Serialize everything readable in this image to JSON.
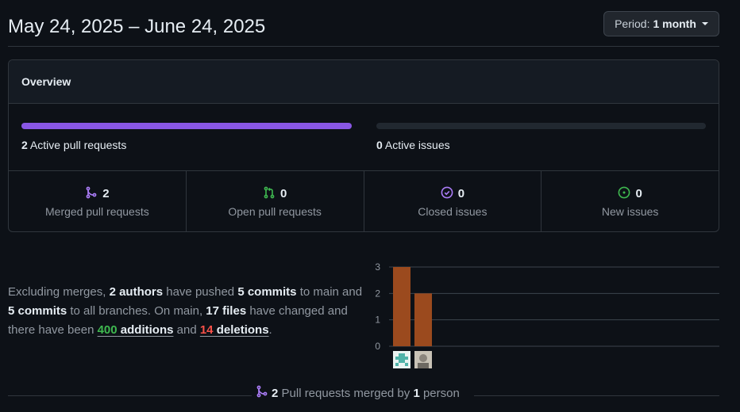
{
  "header": {
    "title": "May 24, 2025 – June 24, 2025",
    "period_label": "Period:",
    "period_value": "1 month"
  },
  "overview": {
    "title": "Overview",
    "active_prs": {
      "count": "2",
      "label": "Active pull requests",
      "fraction": 1.0
    },
    "active_issues": {
      "count": "0",
      "label": "Active issues",
      "fraction": 0.0
    },
    "stats": [
      {
        "icon": "merge-icon",
        "count": "2",
        "label": "Merged pull requests",
        "color": "#ab7df8"
      },
      {
        "icon": "pull-request-icon",
        "count": "0",
        "label": "Open pull requests",
        "color": "#3fb950"
      },
      {
        "icon": "issue-closed-icon",
        "count": "0",
        "label": "Closed issues",
        "color": "#ab7df8"
      },
      {
        "icon": "issue-opened-icon",
        "count": "0",
        "label": "New issues",
        "color": "#3fb950"
      }
    ]
  },
  "summary": {
    "t1": "Excluding merges, ",
    "authors": "2 authors",
    "t2": " have pushed ",
    "commits_main": "5 commits",
    "t3": " to main and ",
    "commits_all": "5 commits",
    "t4": " to all branches. On main, ",
    "files": "17 files",
    "t5": " have changed and there have been ",
    "additions_num": "400",
    "additions_word": " additions",
    "t6": " and ",
    "deletions_num": "14",
    "deletions_word": " deletions",
    "t7": "."
  },
  "chart_data": {
    "type": "bar",
    "categories": [
      "author-1",
      "author-2"
    ],
    "values": [
      3,
      2
    ],
    "ylim": [
      0,
      3
    ],
    "yticks": [
      "0",
      "1",
      "2",
      "3"
    ],
    "bar_color": "#9b4a1e",
    "grid": true
  },
  "footer": {
    "count": "2",
    "t1": " Pull requests merged by ",
    "persons": "1",
    "t2": " person"
  },
  "colors": {
    "background": "#0d1117",
    "accent_purple": "#8957e5",
    "green": "#3fb950",
    "red": "#f85149"
  }
}
